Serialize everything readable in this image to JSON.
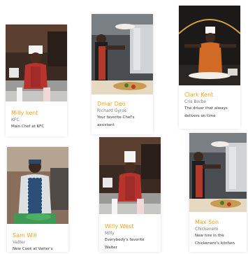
{
  "colors": {
    "accent": "#f2a41b",
    "subtext": "#7a7a7a",
    "text": "#333333"
  },
  "cooks": [
    {
      "name": "Milly kent",
      "place": "KFC",
      "desc": "Main Chef at KFC"
    },
    {
      "name": "Dmar Deo",
      "place": "Richard Gyros",
      "desc": "Your favorite Chef's assistant"
    },
    {
      "name": "Clark Kent",
      "place": "Cris Borbe",
      "desc": "The driver that always delivers on time"
    },
    {
      "name": "Sam Will",
      "place": "Vatter",
      "desc": "New Cook at Vatter's"
    },
    {
      "name": "Willy West",
      "place": "Milly",
      "desc": "Everybody's favorite Waiter"
    },
    {
      "name": "Max Son",
      "place": "Chickenero",
      "desc": "New hire in the Chickenero's kitchen"
    }
  ]
}
